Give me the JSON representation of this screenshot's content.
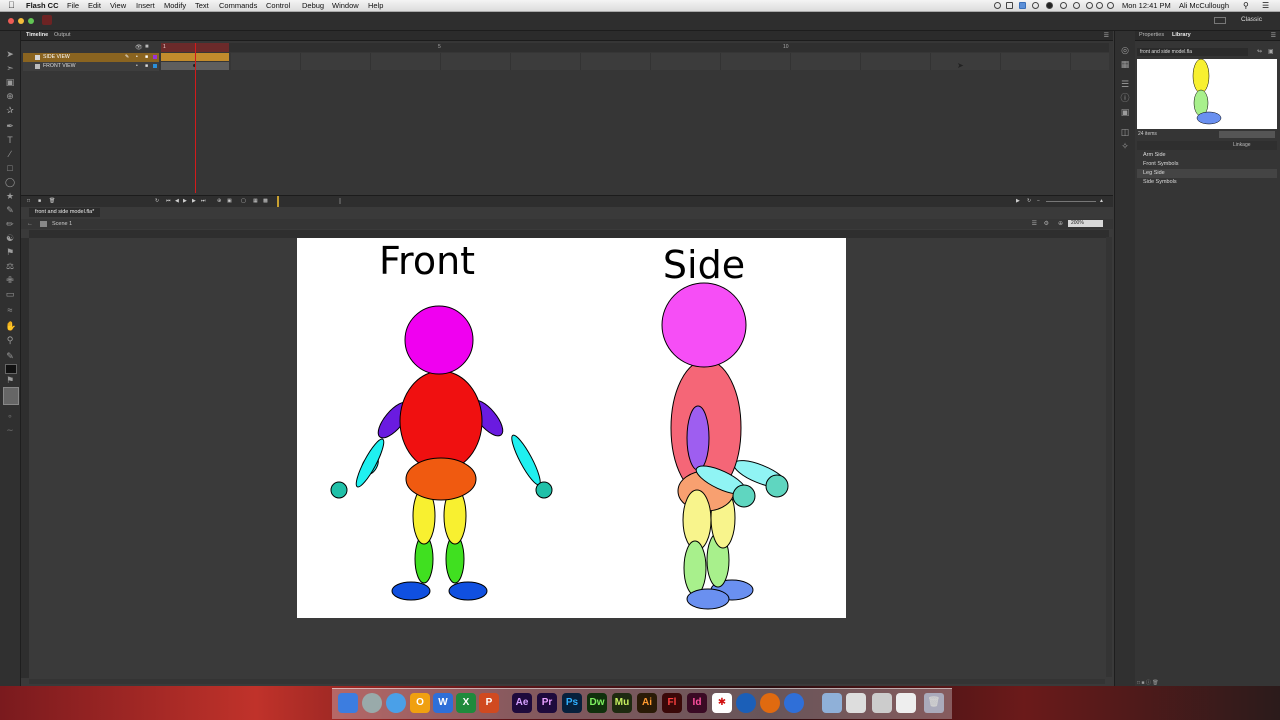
{
  "menubar": {
    "app_name": "Flash CC",
    "items": [
      "File",
      "Edit",
      "View",
      "Insert",
      "Modify",
      "Text",
      "Commands",
      "Control",
      "Debug",
      "Window",
      "Help"
    ],
    "clock": "Mon 12:41 PM",
    "user": "Ali McCullough"
  },
  "workspace": "Classic",
  "timeline": {
    "tabs": [
      "Timeline",
      "Output"
    ],
    "layers": [
      {
        "name": "SIDE VIEW"
      },
      {
        "name": "FRONT VIEW"
      }
    ],
    "frame_numbers": [
      "1",
      "5",
      "10"
    ]
  },
  "document": {
    "tab_title": "front and side model.fla*",
    "scene": "Scene 1",
    "zoom": "200%"
  },
  "stage": {
    "label_front": "Front",
    "label_side": "Side",
    "colors": {
      "head": "#f000f0",
      "torso": "#f01010",
      "hip": "#f05a10",
      "upper_arm": "#6a1be0",
      "forearm": "#1ff0f0",
      "hand": "#20c0a8",
      "thigh": "#f8f030",
      "shin": "#40e020",
      "foot": "#1050e0"
    }
  },
  "library": {
    "tabs": [
      "Properties",
      "Library"
    ],
    "document": "front and side model.fla",
    "item_count": "24 items",
    "column": "Linkage",
    "items": [
      "Arm Side",
      "Front Symbols",
      "Leg Side",
      "Side Symbols"
    ]
  },
  "dock": {
    "apps": [
      "Ae",
      "Pr",
      "Ps",
      "Dw",
      "Mu",
      "Ai",
      "Fl",
      "Id"
    ]
  }
}
